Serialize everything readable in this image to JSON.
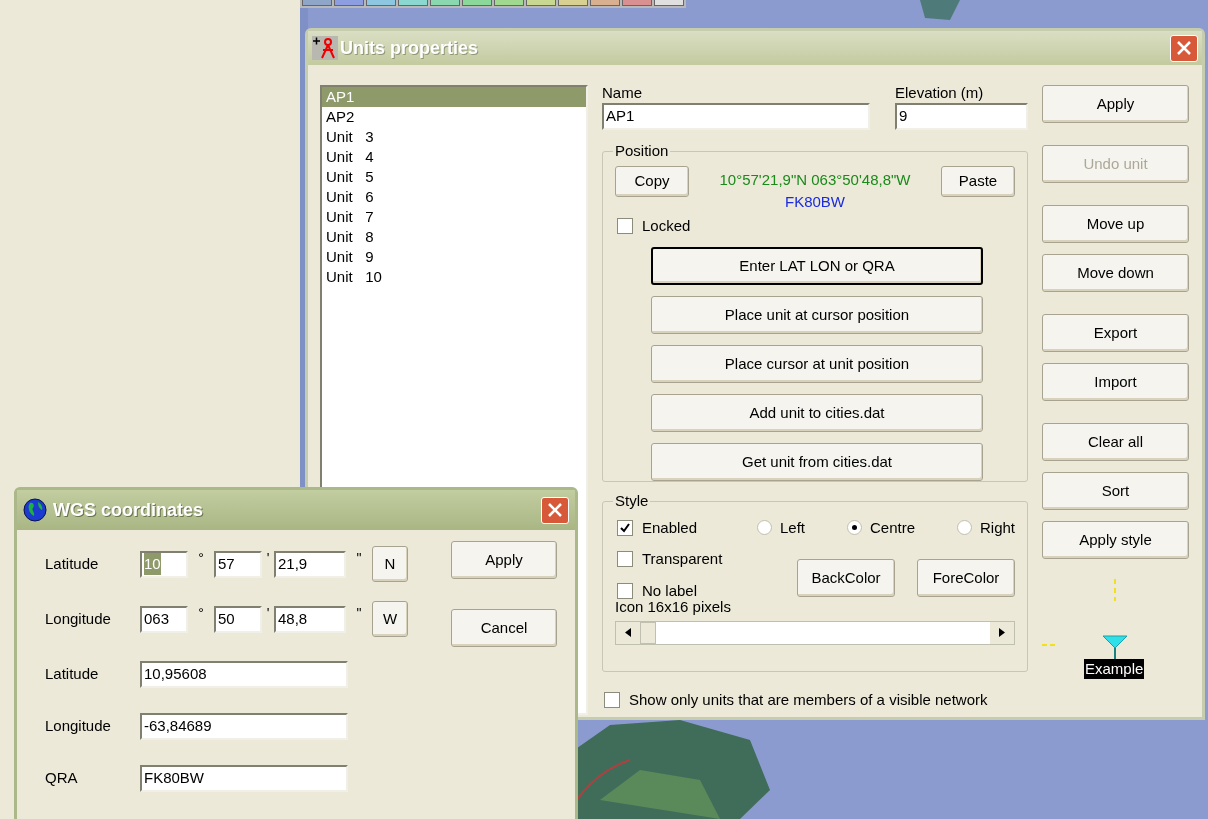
{
  "units_window": {
    "title": "Units properties",
    "units": [
      {
        "label": "AP1",
        "selected": true
      },
      {
        "label": "AP2",
        "selected": false
      },
      {
        "label": "Unit   3",
        "selected": false
      },
      {
        "label": "Unit   4",
        "selected": false
      },
      {
        "label": "Unit   5",
        "selected": false
      },
      {
        "label": "Unit   6",
        "selected": false
      },
      {
        "label": "Unit   7",
        "selected": false
      },
      {
        "label": "Unit   8",
        "selected": false
      },
      {
        "label": "Unit   9",
        "selected": false
      },
      {
        "label": "Unit   10",
        "selected": false
      }
    ],
    "name": {
      "label": "Name",
      "value": "AP1"
    },
    "elevation": {
      "label": "Elevation (m)",
      "value": "9"
    },
    "position": {
      "title": "Position",
      "copy": "Copy",
      "coordinates": "10°57'21,9\"N 063°50'48,8\"W",
      "qra": "FK80BW",
      "paste": "Paste",
      "locked": {
        "label": "Locked",
        "checked": false
      },
      "actions": [
        {
          "label": "Enter LAT LON or QRA",
          "focused": true
        },
        {
          "label": "Place unit at cursor position",
          "focused": false
        },
        {
          "label": "Place cursor at unit position",
          "focused": false
        },
        {
          "label": "Add unit to cities.dat",
          "focused": false
        },
        {
          "label": "Get unit from cities.dat",
          "focused": false
        }
      ]
    },
    "style": {
      "title": "Style",
      "checkboxes": [
        {
          "label": "Enabled",
          "checked": true
        },
        {
          "label": "Transparent",
          "checked": false
        },
        {
          "label": "No label",
          "checked": false
        }
      ],
      "alignments": [
        {
          "label": "Left",
          "selected": false
        },
        {
          "label": "Centre",
          "selected": true
        },
        {
          "label": "Right",
          "selected": false
        }
      ],
      "color_buttons": [
        "BackColor",
        "ForeColor"
      ],
      "icon_size_label": "Icon 16x16 pixels"
    },
    "show_only_visible": {
      "label": "Show only units that are members of a visible network",
      "checked": false
    },
    "side_buttons": [
      [
        {
          "label": "Apply",
          "disabled": false
        }
      ],
      [
        {
          "label": "Undo unit",
          "disabled": true
        }
      ],
      [
        {
          "label": "Move up",
          "disabled": false
        },
        {
          "label": "Move down",
          "disabled": false
        }
      ],
      [
        {
          "label": "Export",
          "disabled": false
        },
        {
          "label": "Import",
          "disabled": false
        }
      ],
      [
        {
          "label": "Clear all",
          "disabled": false
        },
        {
          "label": "Sort",
          "disabled": false
        },
        {
          "label": "Apply style",
          "disabled": false
        }
      ]
    ],
    "example_label": "Example"
  },
  "wgs_window": {
    "title": "WGS coordinates",
    "dms_rows": [
      {
        "label": "Latitude",
        "degrees": "10",
        "degrees_highlighted": true,
        "deg_mark": "°",
        "minutes": "57",
        "min_mark": "'",
        "seconds": "21,9",
        "sec_mark": "\"",
        "hemisphere": "N"
      },
      {
        "label": "Longitude",
        "degrees": "063",
        "degrees_highlighted": false,
        "deg_mark": "°",
        "minutes": "50",
        "min_mark": "'",
        "seconds": "48,8",
        "sec_mark": "\"",
        "hemisphere": "W"
      }
    ],
    "decimal_rows": [
      {
        "label": "Latitude",
        "value": "10,95608"
      },
      {
        "label": "Longitude",
        "value": "-63,84689"
      },
      {
        "label": "QRA",
        "value": "FK80BW"
      }
    ],
    "buttons": [
      "Apply",
      "Cancel"
    ]
  }
}
